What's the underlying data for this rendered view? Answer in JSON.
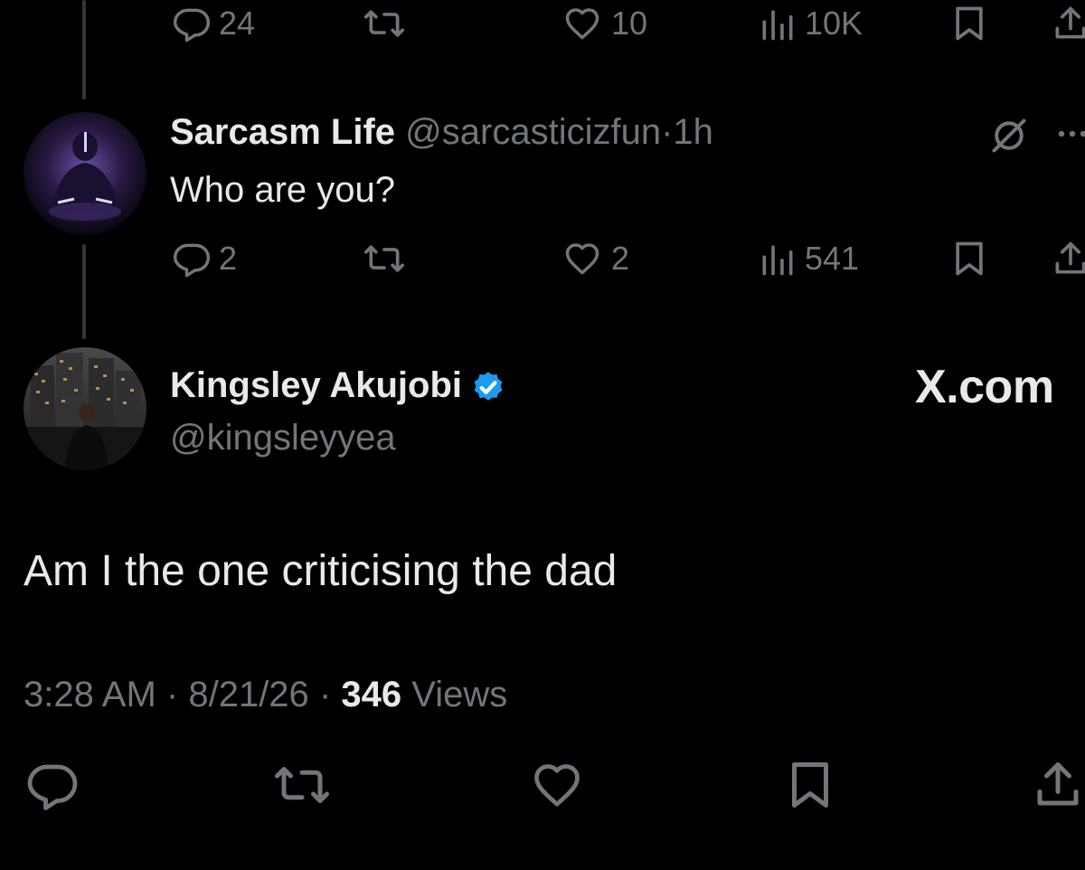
{
  "top_tweet": {
    "actions": {
      "replies": "24",
      "likes": "10",
      "views": "10K"
    }
  },
  "reply_tweet": {
    "name": "Sarcasm Life",
    "handle": "@sarcasticizfun",
    "separator": "·",
    "time": "1h",
    "text": "Who are you?",
    "actions": {
      "replies": "2",
      "likes": "2",
      "views": "541"
    }
  },
  "main_tweet": {
    "name": "Kingsley Akujobi",
    "verified": true,
    "handle": "@kingsleyyea",
    "watermark": "X.com",
    "text": "Am I the one criticising the dad",
    "meta": {
      "time": "3:28 AM",
      "sep1": "·",
      "date": "8/21/26",
      "sep2": "·",
      "views_count": "346",
      "views_label": "Views"
    }
  },
  "colors": {
    "background": "#000000",
    "text": "#e7e9ea",
    "muted": "#71767b",
    "verified": "#1d9bf0",
    "thread_line": "#333639"
  }
}
